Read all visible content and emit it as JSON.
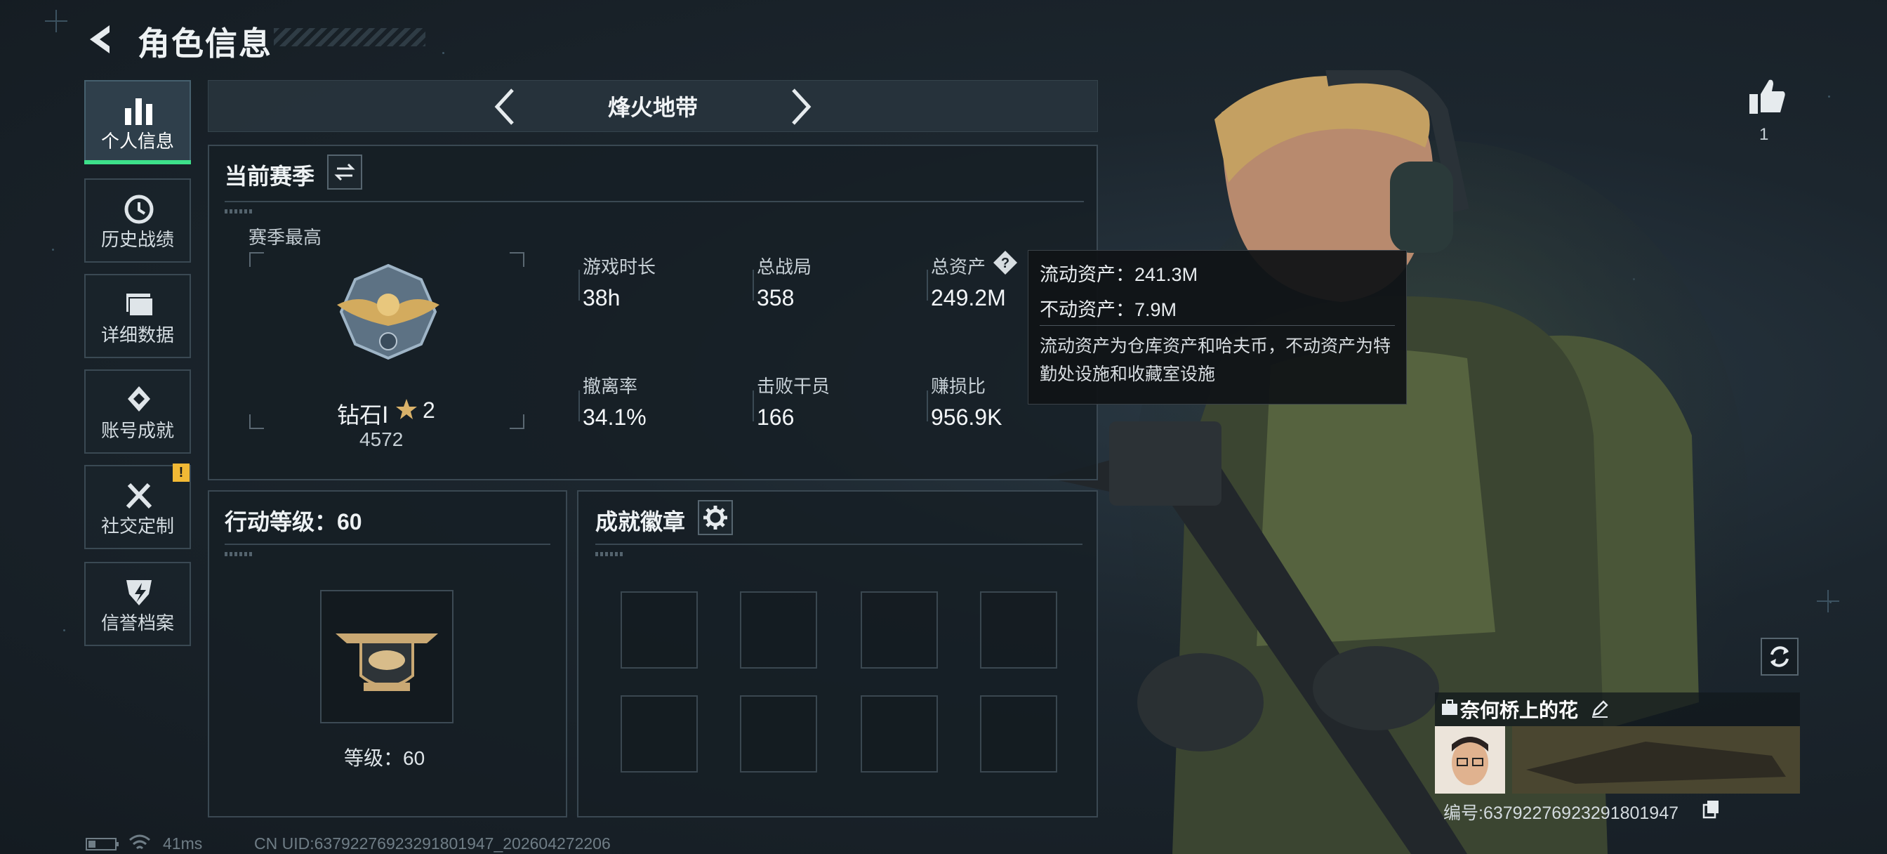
{
  "header": {
    "title": "角色信息"
  },
  "sidebar": {
    "items": [
      {
        "label": "个人信息",
        "icon": "bar-chart-icon",
        "active": true
      },
      {
        "label": "历史战绩",
        "icon": "history-clock-icon"
      },
      {
        "label": "详细数据",
        "icon": "folder-icon"
      },
      {
        "label": "账号成就",
        "icon": "achievement-icon"
      },
      {
        "label": "社交定制",
        "icon": "tools-icon",
        "badge": "!"
      },
      {
        "label": "信誉档案",
        "icon": "lightning-shield-icon"
      }
    ]
  },
  "mode_selector": {
    "title": "烽火地带"
  },
  "season": {
    "title": "当前赛季",
    "best_label": "赛季最高",
    "rank_name": "钻石Ⅰ",
    "rank_stars": "2",
    "rank_score": "4572",
    "stats": [
      {
        "label": "游戏时长",
        "value": "38h"
      },
      {
        "label": "总战局",
        "value": "358"
      },
      {
        "label": "总资产",
        "value": "249.2M"
      },
      {
        "label": "撤离率",
        "value": "34.1%"
      },
      {
        "label": "击败干员",
        "value": "166"
      },
      {
        "label": "赚损比",
        "value": "956.9K"
      }
    ]
  },
  "tooltip": {
    "line1": "流动资产：241.3M",
    "line2": "不动资产：7.9M",
    "desc": "流动资产为仓库资产和哈夫币，不动资产为特勤处设施和收藏室设施"
  },
  "level": {
    "title": "行动等级：60",
    "label": "等级：60"
  },
  "badges": {
    "title": "成就徽章",
    "slots": 8
  },
  "likes": {
    "count": "1"
  },
  "player": {
    "name": "奈何桥上的花",
    "id_text": "编号:63792276923291801947"
  },
  "footer": {
    "ping": "41ms",
    "uid": "CN UID:63792276923291801947_202604272206"
  },
  "colors": {
    "accent": "#3de08a",
    "warning": "#f2b935"
  }
}
